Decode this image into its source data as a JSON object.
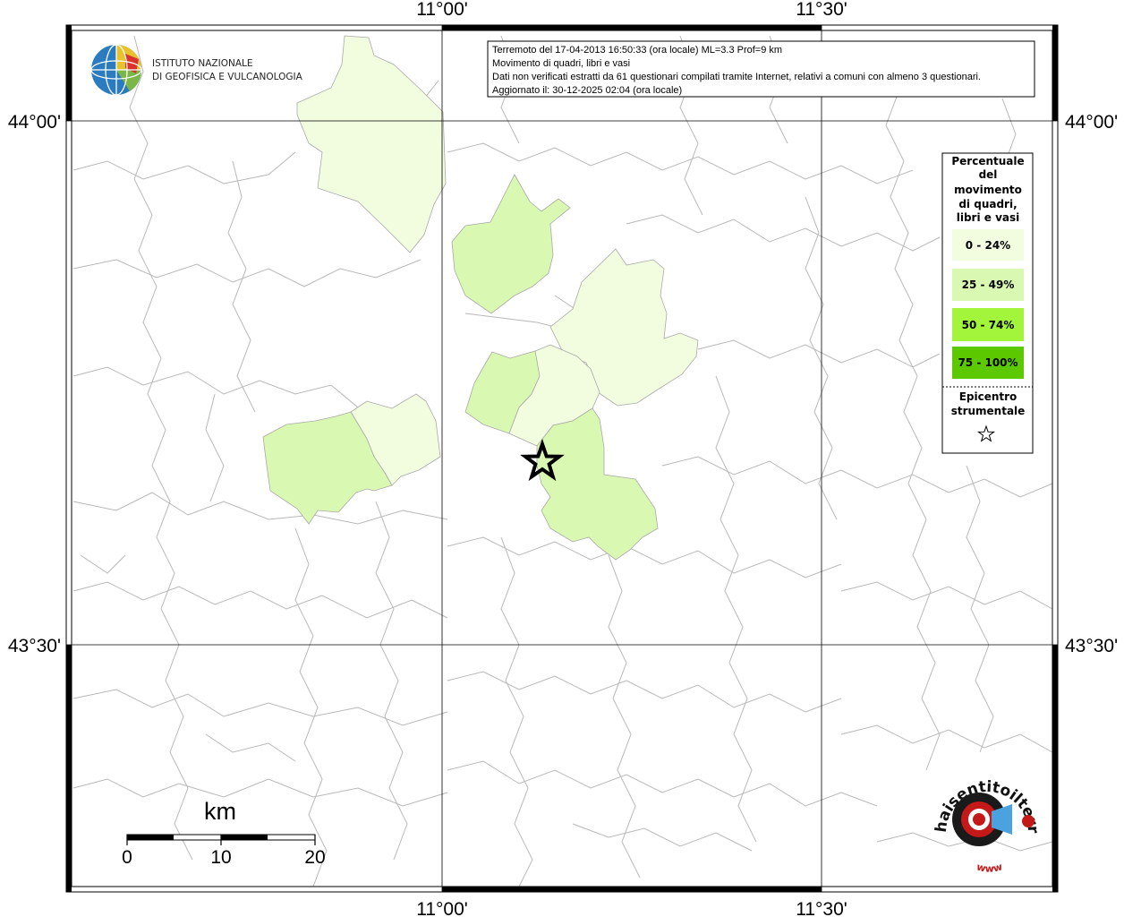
{
  "institute": {
    "name_line1": "ISTITUTO NAZIONALE",
    "name_line2": "DI GEOFISICA E VULCANOLOGIA"
  },
  "info": {
    "line1": "Terremoto del 17-04-2013 16:50:33 (ora locale) ML=3.3 Prof=9 km",
    "line2": "Movimento di quadri, libri e vasi",
    "line3": "Dati non verificati estratti da 61 questionari compilati tramite Internet, relativi a comuni con almeno 3 questionari.",
    "line4": "Aggiornato il: 30-12-2025 02:04 (ora locale)"
  },
  "axes": {
    "lon_top_1": "11°00'",
    "lon_top_2": "11°30'",
    "lon_bottom_1": "11°00'",
    "lon_bottom_2": "11°30'",
    "lat_left_1": "44°00'",
    "lat_left_2": "43°30'",
    "lat_right_1": "44°00'",
    "lat_right_2": "43°30'"
  },
  "legend": {
    "title_lines": [
      "Percentuale",
      "del",
      "movimento",
      "di quadri,",
      "libri e vasi"
    ],
    "classes": [
      {
        "label": "0 - 24%",
        "color": "#f2fddf"
      },
      {
        "label": "25 - 49%",
        "color": "#d9f8b1"
      },
      {
        "label": "50 - 74%",
        "color": "#a2f53a"
      },
      {
        "label": "75 - 100%",
        "color": "#5cc900"
      }
    ],
    "epicenter_lines": [
      "Epicentro",
      "strumentale"
    ]
  },
  "scale": {
    "unit": "km",
    "labels": [
      "0",
      "10",
      "20"
    ]
  },
  "logo": {
    "text_main": "haisentitoilterremoto.it",
    "text_www": "www"
  }
}
